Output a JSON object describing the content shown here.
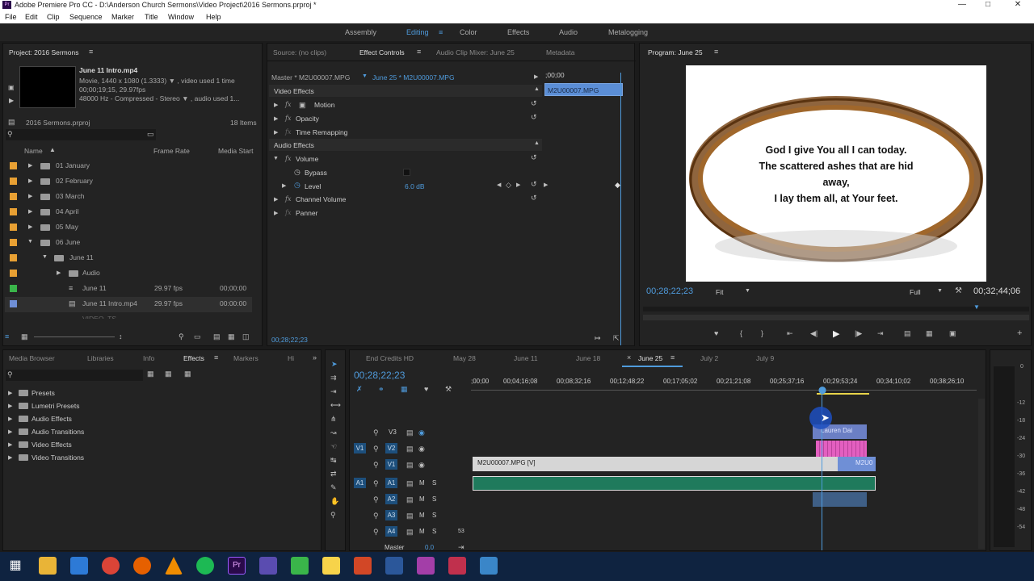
{
  "window": {
    "title": "Adobe Premiere Pro CC - D:\\Anderson Church Sermons\\Video Project\\2016 Sermons.prproj *"
  },
  "menu": [
    "File",
    "Edit",
    "Clip",
    "Sequence",
    "Marker",
    "Title",
    "Window",
    "Help"
  ],
  "workspaces": [
    "Assembly",
    "Editing",
    "Color",
    "Effects",
    "Audio",
    "Metalogging"
  ],
  "project": {
    "tab": "Project: 2016 Sermons",
    "clip_name": "June 11 Intro.mp4",
    "clip_info1": "Movie, 1440 x 1080 (1.3333)",
    "clip_info1b": ", video used 1 time",
    "clip_info2": "00;00;19;15, 29.97fps",
    "clip_info3": "48000 Hz - Compressed - Stereo",
    "clip_info3b": ", audio used 1...",
    "file": "2016 Sermons.prproj",
    "items": "18 Items",
    "col_name": "Name",
    "col_rate": "Frame Rate",
    "col_start": "Media Start",
    "rows": [
      {
        "name": "01 January",
        "rate": "",
        "start": ""
      },
      {
        "name": "02 February",
        "rate": "",
        "start": ""
      },
      {
        "name": "03 March",
        "rate": "",
        "start": ""
      },
      {
        "name": "04 April",
        "rate": "",
        "start": ""
      },
      {
        "name": "05 May",
        "rate": "",
        "start": ""
      },
      {
        "name": "06 June",
        "rate": "",
        "start": ""
      },
      {
        "name": "June 11",
        "rate": "",
        "start": ""
      },
      {
        "name": "Audio",
        "rate": "",
        "start": ""
      },
      {
        "name": "June 11",
        "rate": "29.97 fps",
        "start": "00;00;00"
      },
      {
        "name": "June 11 Intro.mp4",
        "rate": "29.97 fps",
        "start": "00:00:00"
      },
      {
        "name": "VIDEO_TS",
        "rate": "",
        "start": ""
      }
    ],
    "colors": {
      "orange": "#e8a033",
      "green": "#3ab54a",
      "blue": "#6f8fd6"
    }
  },
  "source_tabs": [
    "Source: (no clips)",
    "Effect Controls",
    "Audio Clip Mixer: June 25",
    "Metadata"
  ],
  "effect_controls": {
    "master": "Master * M2U00007.MPG",
    "seq": "June 25 * M2U00007.MPG",
    "time_start": ";00;00",
    "clip_label": "M2U00007.MPG",
    "video_effects": "Video Effects",
    "motion": "Motion",
    "opacity": "Opacity",
    "time_remap": "Time Remapping",
    "audio_effects": "Audio Effects",
    "volume": "Volume",
    "bypass": "Bypass",
    "level": "Level",
    "level_val": "6.0 dB",
    "channel_volume": "Channel Volume",
    "panner": "Panner",
    "timecode": "00;28;22;23"
  },
  "program": {
    "tab": "Program: June 25",
    "text_line1": "God I give You all I can today.",
    "text_line2": "The scattered ashes that are hid",
    "text_line3": "away,",
    "text_line4": "I lay them all, at Your feet.",
    "timecode": "00;28;22;23",
    "fit": "Fit",
    "full": "Full",
    "duration": "00;32;44;06"
  },
  "effects_panel": {
    "tabs": [
      "Media Browser",
      "Libraries",
      "Info",
      "Effects",
      "Markers",
      "Hi"
    ],
    "items": [
      "Presets",
      "Lumetri Presets",
      "Audio Effects",
      "Audio Transitions",
      "Video Effects",
      "Video Transitions"
    ]
  },
  "timeline": {
    "seq_tabs": [
      "End Credits HD",
      "May 28",
      "June 11",
      "June 18",
      "June 25",
      "July 2",
      "July 9"
    ],
    "timecode": "00;28;22;23",
    "ruler": [
      ";00;00",
      "00;04;16;08",
      "00;08;32;16",
      "00;12;48;22",
      "00;17;05;02",
      "00;21;21;08",
      "00;25;37;16",
      "00;29;53;24",
      "00;34;10;02",
      "00;38;26;10"
    ],
    "tracks_v": [
      "V3",
      "V2",
      "V1"
    ],
    "tracks_a": [
      "A1",
      "A2",
      "A3",
      "A4"
    ],
    "src_v": "V1",
    "src_a": "A1",
    "master": "Master",
    "master_val": "0.0",
    "clip_v1": "M2U00007.MPG [V]",
    "clip_v1b": "M2U0",
    "clip_v3": "Lauren Dai",
    "a4_val": "53",
    "m": "M",
    "s": "S"
  },
  "meter": [
    "0",
    "-12",
    "-18",
    "-24",
    "-30",
    "-36",
    "-42",
    "-48",
    "-54"
  ],
  "colors": {
    "accent": "#4f9bdc",
    "audio_clip": "#1f7a5c",
    "video_clip": "#d6d6d6",
    "pink": "#e35fc0",
    "track_sel": "#1d4f7c"
  }
}
